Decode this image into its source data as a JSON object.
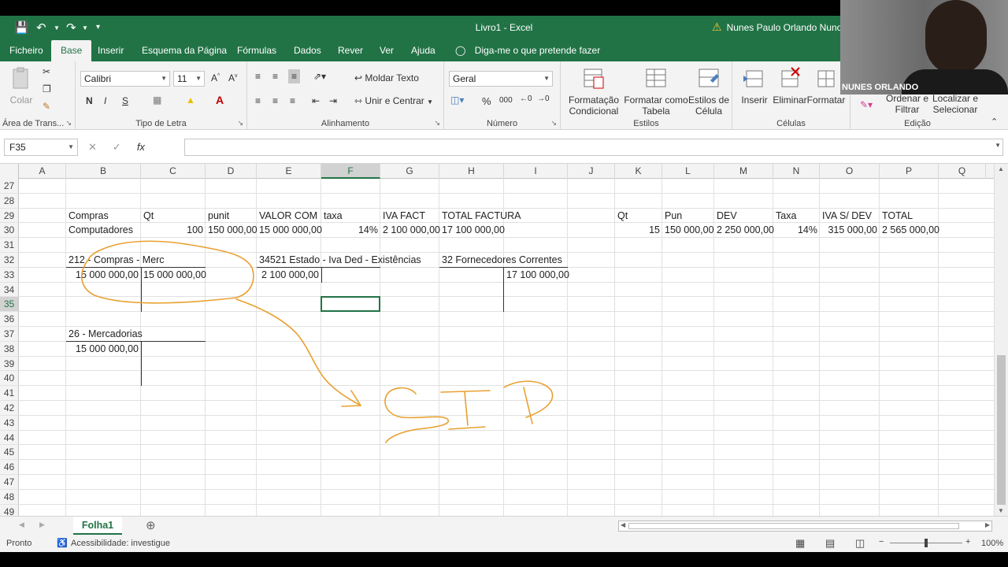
{
  "window": {
    "doc_title": "Livro1  -  Excel",
    "user_name": "Nunes Paulo Orlando Nuno",
    "webcam_name": "NUNES ORLANDO"
  },
  "tabs": [
    "Ficheiro",
    "Base",
    "Inserir",
    "Esquema da Página",
    "Fórmulas",
    "Dados",
    "Rever",
    "Ver",
    "Ajuda"
  ],
  "tell_me": "Diga-me o que pretende fazer",
  "ribbon": {
    "clipboard": {
      "label": "Área de Trans...",
      "paste": "Colar"
    },
    "font": {
      "label": "Tipo de Letra",
      "name": "Calibri",
      "size": "11",
      "bold": "N",
      "italic": "I",
      "underline": "S"
    },
    "alignment": {
      "label": "Alinhamento",
      "wrap": "Moldar Texto",
      "merge": "Unir e Centrar"
    },
    "number": {
      "label": "Número",
      "format": "Geral",
      "percent": "%",
      "thousands": "000"
    },
    "styles": {
      "label": "Estilos",
      "cond": "Formatação Condicional",
      "table": "Formatar como Tabela",
      "cell": "Estilos de Célula"
    },
    "cells": {
      "label": "Células",
      "insert": "Inserir",
      "delete": "Eliminar",
      "format": "Formatar"
    },
    "editing": {
      "label": "Edição",
      "sort": "Ordenar e Filtrar",
      "find": "Localizar e Selecionar"
    }
  },
  "formula_bar": {
    "name_box": "F35",
    "fx": "fx",
    "formula": ""
  },
  "columns": [
    "A",
    "B",
    "C",
    "D",
    "E",
    "F",
    "G",
    "H",
    "I",
    "J",
    "K",
    "L",
    "M",
    "N",
    "O",
    "P",
    "Q"
  ],
  "rows": [
    "27",
    "28",
    "29",
    "30",
    "31",
    "32",
    "33",
    "34",
    "35",
    "36",
    "37",
    "38",
    "39",
    "40",
    "41",
    "42",
    "43",
    "44",
    "45",
    "46",
    "47",
    "48",
    "49"
  ],
  "cells": {
    "B29": "Compras",
    "C29": "Qt",
    "D29": "punit",
    "E29": "VALOR COM",
    "F29": "taxa",
    "G29": "IVA FACT",
    "H29": "TOTAL FACTURA",
    "K29": "Qt",
    "L29": "Pun",
    "M29": "DEV",
    "N29": "Taxa",
    "O29": "IVA S/ DEV",
    "P29": "TOTAL",
    "B30": "Computadores",
    "C30": "100",
    "D30": "150 000,00",
    "E30": "15 000 000,00",
    "F30": "14%",
    "G30": "2 100 000,00",
    "H30": "17 100 000,00",
    "K30": "15",
    "L30": "150 000,00",
    "M30": "2 250 000,00",
    "N30": "14%",
    "O30": "315 000,00",
    "P30": "2 565 000,00",
    "B32": "212 - Compras - Merc",
    "E32": "34521 Estado - Iva Ded - Existências",
    "H32": "32 Fornecedores Correntes",
    "B33": "15 000 000,00",
    "C33": "15 000 000,00",
    "E33": "2 100 000,00",
    "I33": "17 100 000,00",
    "B37": "26 - Mercadorias",
    "B38": "15 000 000,00"
  },
  "sheet_tab": "Folha1",
  "status": {
    "ready": "Pronto",
    "accessibility": "Acessibilidade: investigue",
    "zoom": "100%"
  },
  "ink_color": "#e8a030",
  "accent": "#217346"
}
